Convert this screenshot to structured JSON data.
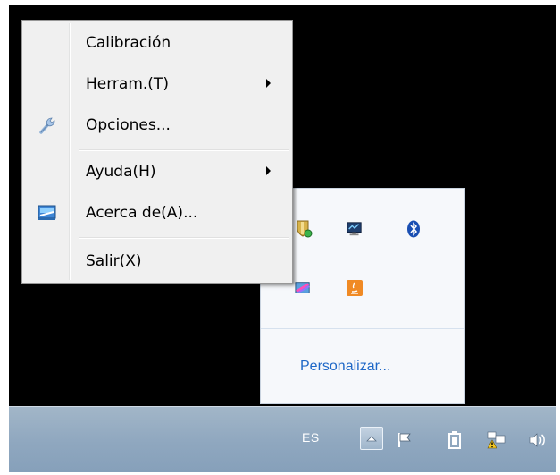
{
  "context_menu": {
    "items": [
      {
        "label": "Calibración",
        "icon": "",
        "has_submenu": false
      },
      {
        "label": "Herram.(T)",
        "icon": "",
        "has_submenu": true
      },
      {
        "label": "Opciones...",
        "icon": "wrench-icon",
        "has_submenu": false
      },
      {
        "label": "Ayuda(H)",
        "icon": "",
        "has_submenu": true
      },
      {
        "label": "Acerca de(A)...",
        "icon": "display-settings-icon",
        "has_submenu": false
      },
      {
        "label": "Salir(X)",
        "icon": "",
        "has_submenu": false
      }
    ]
  },
  "notification_overflow": {
    "icons": [
      "security-shield-icon",
      "network-monitor-icon",
      "bluetooth-icon",
      "display-tool-icon",
      "java-icon"
    ],
    "customize_link": "Personalizar..."
  },
  "taskbar": {
    "language": "ES",
    "tray_icons": [
      "show-hidden-icons-button",
      "action-center-flag-icon",
      "battery-icon",
      "network-warning-icon",
      "volume-icon"
    ]
  },
  "colors": {
    "desktop": "#000000",
    "menu_background": "#f0f0f0",
    "link": "#1f68c7",
    "taskbar": "#8fa7bf"
  }
}
